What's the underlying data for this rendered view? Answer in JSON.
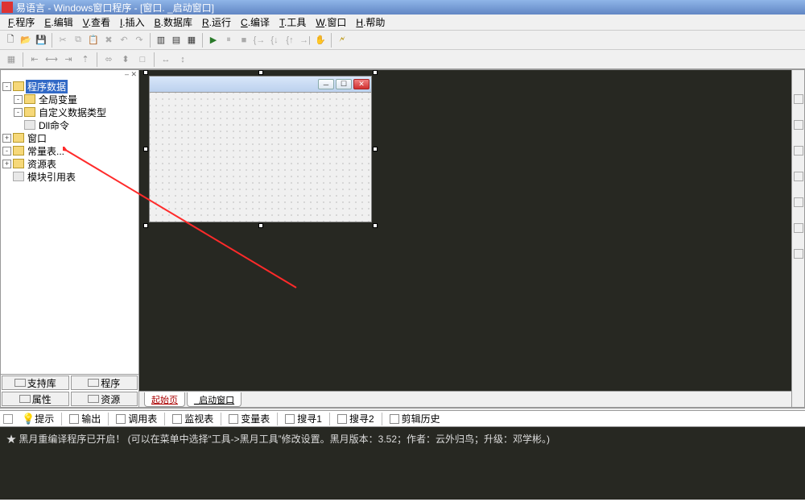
{
  "title": "易语言 - Windows窗口程序 - [窗口. _启动窗口]",
  "menus": [
    "F.程序",
    "E.编辑",
    "V.查看",
    "I.插入",
    "B.数据库",
    "R.运行",
    "C.编译",
    "T.工具",
    "W.窗口",
    "H.帮助"
  ],
  "tree": {
    "root": "程序数据",
    "items": [
      {
        "label": "全局变量",
        "exp": "-",
        "ind": 1,
        "icon": "folder"
      },
      {
        "label": "自定义数据类型",
        "exp": "-",
        "ind": 1,
        "icon": "folder"
      },
      {
        "label": "Dll命令",
        "exp": "",
        "ind": 1,
        "icon": "leaf"
      },
      {
        "label": "窗口",
        "exp": "+",
        "ind": 0,
        "icon": "folder"
      },
      {
        "label": "常量表...",
        "exp": "-",
        "ind": 0,
        "icon": "folder"
      },
      {
        "label": "资源表",
        "exp": "+",
        "ind": 0,
        "icon": "folder"
      },
      {
        "label": "模块引用表",
        "exp": "",
        "ind": 0,
        "icon": "leaf"
      }
    ]
  },
  "leftButtons": {
    "a": "支持库",
    "b": "程序",
    "c": "属性",
    "d": "资源"
  },
  "editorTabs": {
    "start": "起始页",
    "launch": "_启动窗口"
  },
  "bottomTabs": [
    "提示",
    "输出",
    "调用表",
    "监视表",
    "变量表",
    "搜寻1",
    "搜寻2",
    "剪辑历史"
  ],
  "console": {
    "line1": "★ 黑月重编译程序已开启！  (可以在菜单中选择“工具->黑月工具”修改设置。黑月版本：3.52；作者：云外归鸟；升级：邓学彬。)"
  }
}
